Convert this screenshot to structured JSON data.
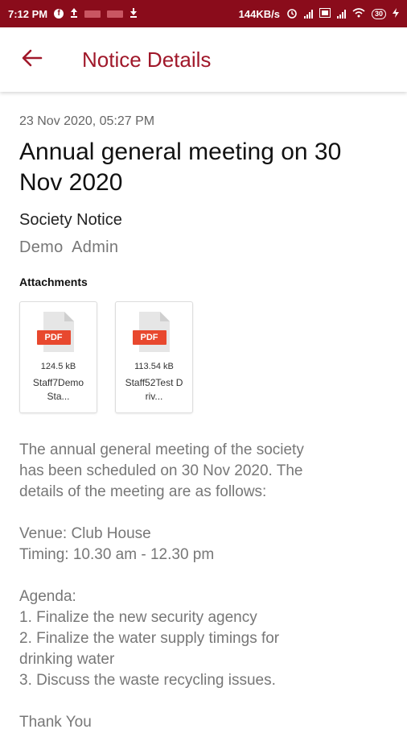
{
  "status_bar": {
    "time": "7:12 PM",
    "speed": "144KB/s",
    "battery": "30",
    "icons": [
      "facebook-icon",
      "upload-icon",
      "notification-icon",
      "notification-icon",
      "download-icon",
      "alarm-icon",
      "signal-icon",
      "volte-icon",
      "signal-icon",
      "wifi-icon",
      "battery-icon",
      "charging-icon"
    ]
  },
  "app_bar": {
    "title": "Notice Details",
    "back_icon": "arrow-left-icon",
    "accent": "#a0182a",
    "status_color": "#8a0c1b"
  },
  "notice": {
    "timestamp": "23 Nov 2020, 05:27 PM",
    "title": "Annual general meeting on 30 Nov 2020",
    "category": "Society Notice",
    "author": "Demo  Admin",
    "attachments_heading": "Attachments",
    "attachments": [
      {
        "type": "PDF",
        "size": "124.5 kB",
        "name": "Staff7Demo Sta..."
      },
      {
        "type": "PDF",
        "size": "113.54 kB",
        "name": "Staff52Test Driv..."
      }
    ],
    "body": {
      "p1": [
        "The annual general meeting of the society",
        "has been scheduled on 30 Nov 2020. The",
        "details of the meeting are as follows:"
      ],
      "p2": [
        "Venue: Club House",
        "Timing: 10.30 am - 12.30 pm"
      ],
      "p3": [
        "Agenda:",
        "1. Finalize the new security agency",
        "2. Finalize the water supply timings for",
        "drinking water",
        "3. Discuss the waste recycling issues."
      ],
      "p4": [
        "Thank You"
      ]
    }
  }
}
